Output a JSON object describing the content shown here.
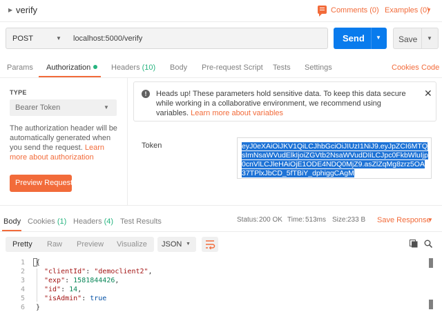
{
  "request": {
    "name": "verify",
    "comments_label": "Comments (0)",
    "examples_label": "Examples (0)",
    "method": "POST",
    "url": "localhost:5000/verify",
    "send_label": "Send",
    "save_label": "Save"
  },
  "request_tabs": {
    "params": "Params",
    "authorization": "Authorization",
    "headers": "Headers",
    "headers_count": "(10)",
    "body": "Body",
    "prerequest": "Pre-request Script",
    "tests": "Tests",
    "settings": "Settings",
    "cookies": "Cookies",
    "code": "Code"
  },
  "auth": {
    "type_label": "TYPE",
    "type_value": "Bearer Token",
    "description": "The authorization header will be automatically generated when you send the request. ",
    "learn_more": "Learn more about authorization",
    "preview_button": "Preview Request",
    "warning_text": "Heads up! These parameters hold sensitive data. To keep this data secure while working in a collaborative environment, we recommend using variables. ",
    "warning_link": "Learn more about variables",
    "token_label": "Token",
    "token_value": "eyJ0eXAiOiJKV1QiLCJhbGciOiJIUzI1NiJ9.eyJpZCI6MTQsImNsaWVudElkIjoiZGVtb2NsaWVudDIiLCJpc0FkbWluIjp0cnVlLCJleHAiOjE1ODE4NDQ0MjZ9.asZlZqMg8zrz5OA37TPlxJbCD_5fTBiY_dphiggCAgM"
  },
  "response_tabs": {
    "body": "Body",
    "cookies": "Cookies",
    "cookies_count": "(1)",
    "headers": "Headers",
    "headers_count": "(4)",
    "test_results": "Test Results"
  },
  "response_stats": {
    "status_label": "Status:",
    "status_value": "200 OK",
    "time_label": "Time:",
    "time_value": "513ms",
    "size_label": "Size:",
    "size_value": "233 B",
    "save_response": "Save Response"
  },
  "view": {
    "pretty": "Pretty",
    "raw": "Raw",
    "preview": "Preview",
    "visualize": "Visualize",
    "format": "JSON"
  },
  "code": {
    "line_numbers": [
      "1",
      "2",
      "3",
      "4",
      "5",
      "6"
    ],
    "open_brace": "{",
    "close_brace": "}",
    "client_key": "\"clientId\"",
    "client_val": "\"democlient2\"",
    "exp_key": "\"exp\"",
    "exp_val": "1581844426",
    "id_key": "\"id\"",
    "id_val": "14",
    "admin_key": "\"isAdmin\"",
    "admin_val": "true"
  },
  "colors": {
    "accent": "#f26b3a",
    "send_blue": "#097bed",
    "success_green": "#26b47f"
  }
}
